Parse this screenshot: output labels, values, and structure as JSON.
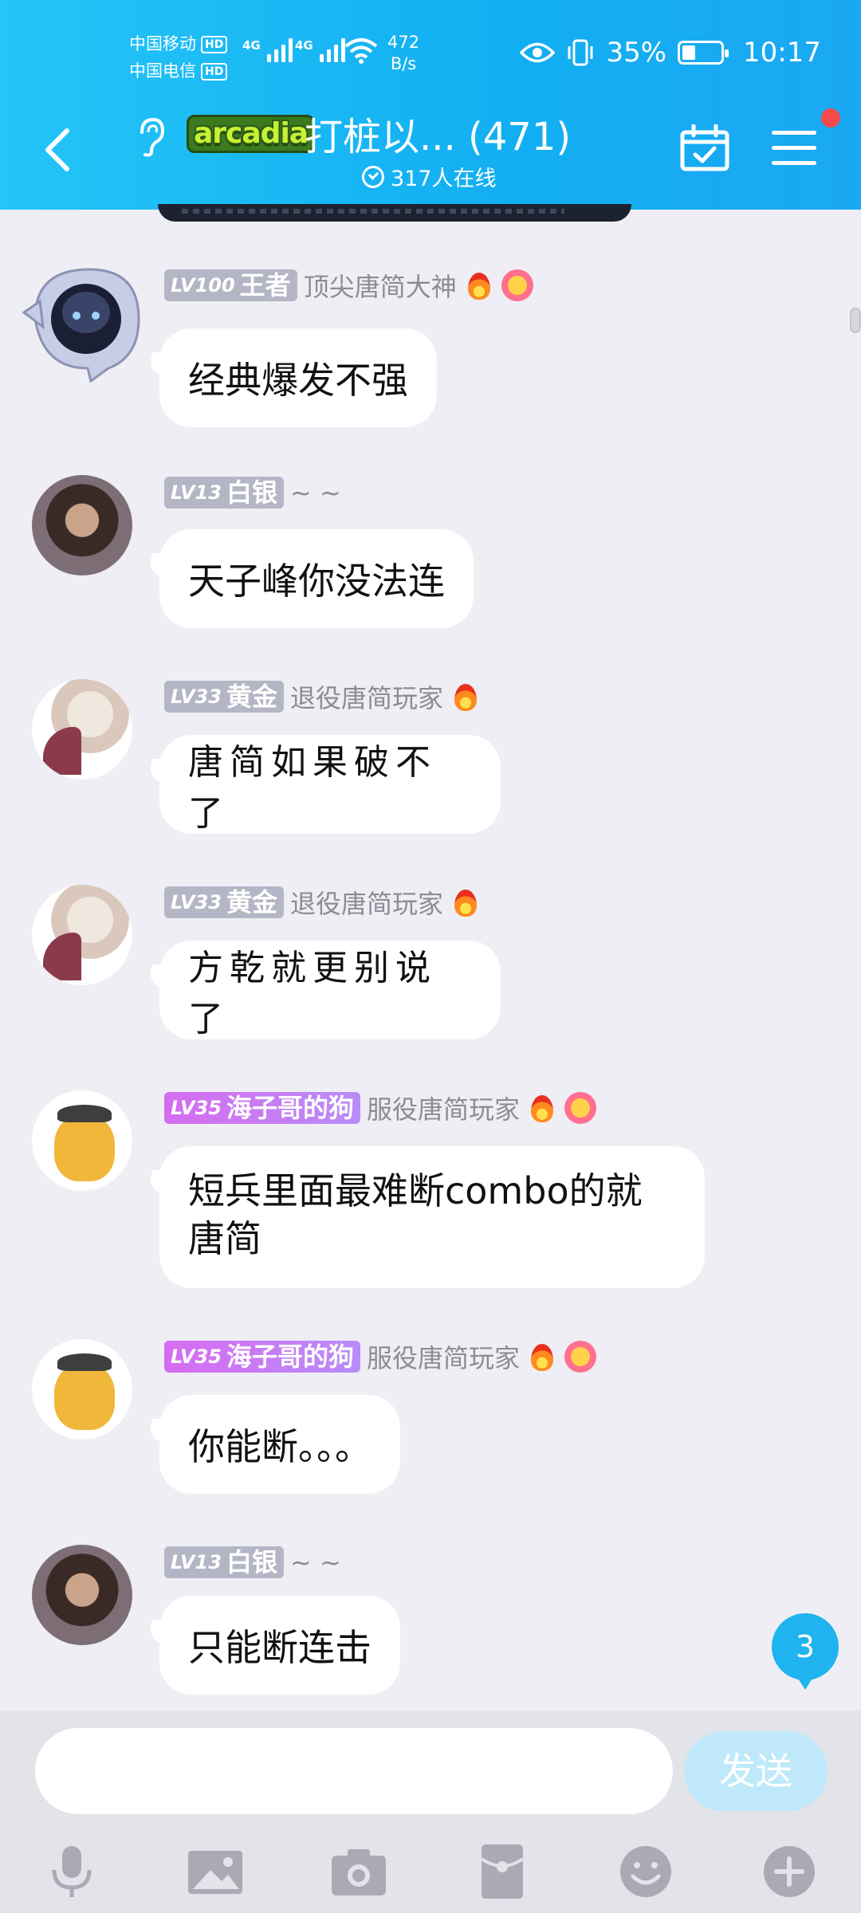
{
  "status_bar": {
    "carrier1": "中国移动",
    "carrier2": "中国电信",
    "hd": "HD",
    "net1": "4G",
    "net2": "4G",
    "speed_value": "472",
    "speed_unit": "B/s",
    "battery": "35%",
    "battery_level": 0.35,
    "time": "10:17"
  },
  "header": {
    "game_logo_text": "arcadia",
    "group_title": "打桩以... (471)",
    "online_text": "317人在线"
  },
  "messages": [
    {
      "level": "LV100",
      "rank": "王者",
      "title": "顶尖唐简大神",
      "text": "经典爆发不强"
    },
    {
      "level": "LV13",
      "rank": "白银",
      "title": "~ ~",
      "text": "天子峰你没法连"
    },
    {
      "level": "LV33",
      "rank": "黄金",
      "title": "退役唐简玩家",
      "text": "唐简如果破不了"
    },
    {
      "level": "LV33",
      "rank": "黄金",
      "title": "退役唐简玩家",
      "text": "方乾就更别说了"
    },
    {
      "level": "LV35",
      "rank": "海子哥的狗",
      "title": "服役唐简玩家",
      "text": "短兵里面最难断combo的就唐简"
    },
    {
      "level": "LV35",
      "rank": "海子哥的狗",
      "title": "服役唐简玩家",
      "text": "你能断。。。"
    },
    {
      "level": "LV13",
      "rank": "白银",
      "title": "~ ~",
      "text": "只能断连击"
    }
  ],
  "unread_count": "3",
  "input": {
    "placeholder": "",
    "value": "",
    "send_label": "发送"
  },
  "colors": {
    "header_blue": "#12aef2",
    "badge_gray": "#b4b6c6",
    "badge_purple": "#c77cf4",
    "send_disabled": "#bfe9fb"
  }
}
